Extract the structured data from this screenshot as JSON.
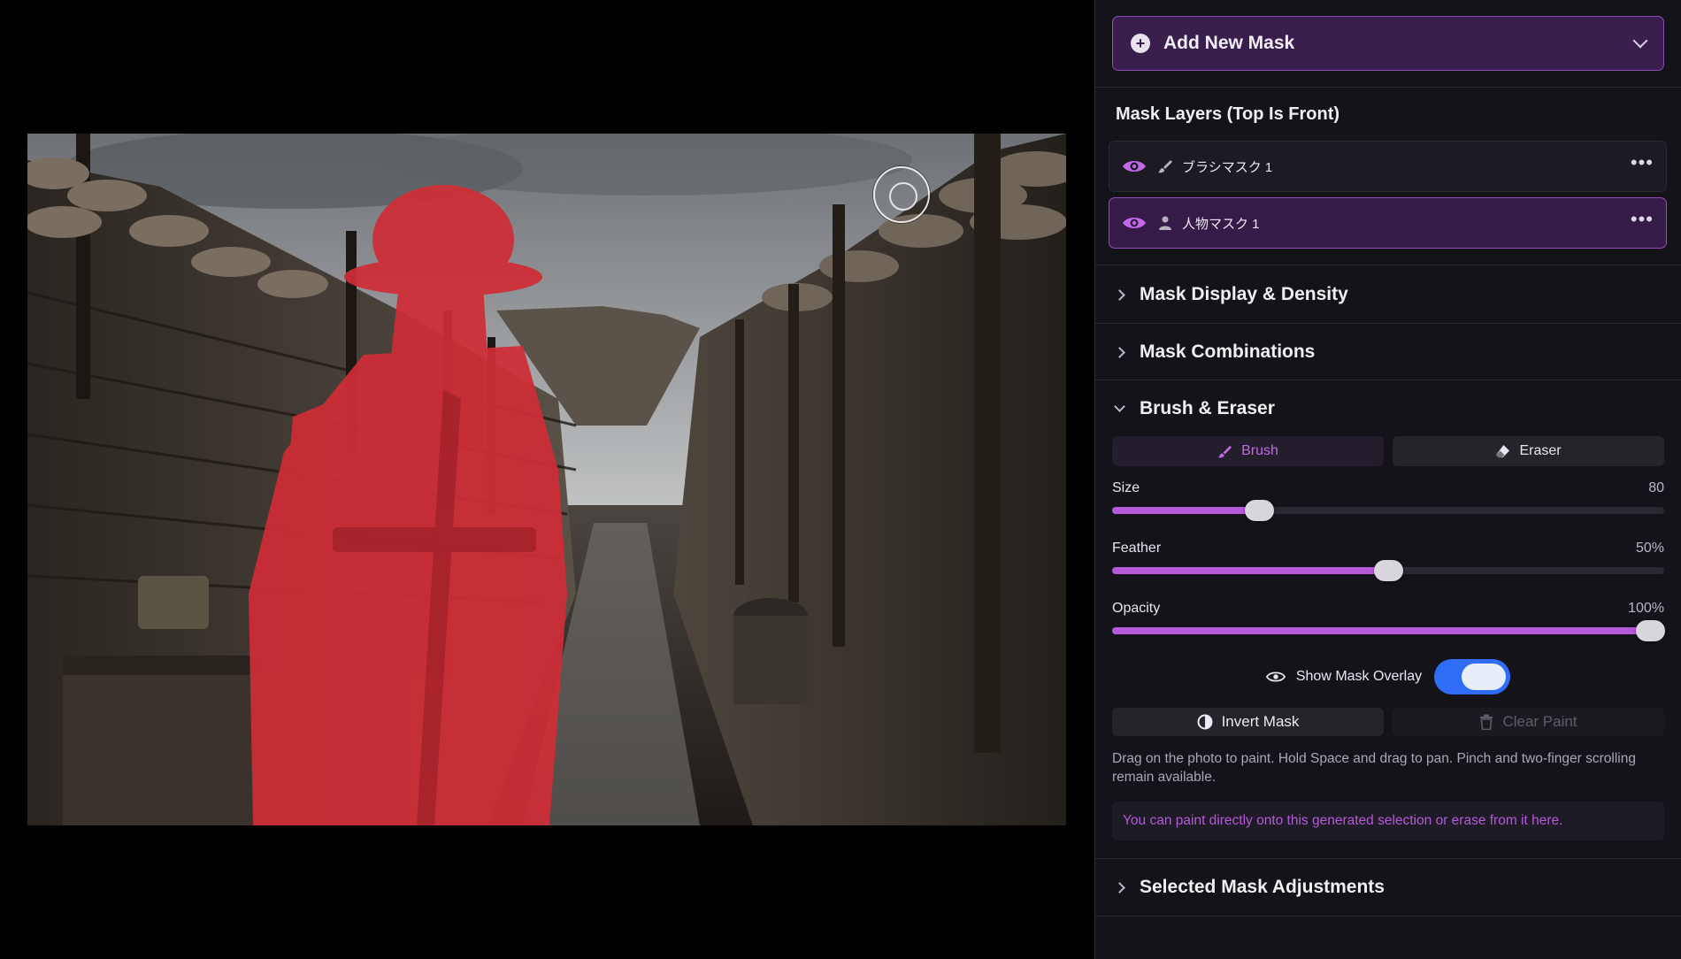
{
  "panel": {
    "add_mask": {
      "label": "Add New Mask",
      "icon": "plus-circle-icon"
    },
    "layers_title": "Mask Layers (Top Is Front)",
    "layers": [
      {
        "name": "ブラシマスク 1",
        "icon": "brush-icon",
        "visible": true,
        "selected": false
      },
      {
        "name": "人物マスク 1",
        "icon": "person-icon",
        "visible": true,
        "selected": true
      }
    ],
    "sections": {
      "display": "Mask Display & Density",
      "combinations": "Mask Combinations",
      "brush_eraser": "Brush & Eraser",
      "adjustments": "Selected Mask Adjustments"
    },
    "tools": {
      "brush": "Brush",
      "eraser": "Eraser",
      "active": "brush"
    },
    "sliders": {
      "size": {
        "label": "Size",
        "value": "80",
        "fraction": 0.266
      },
      "feather": {
        "label": "Feather",
        "value": "50%",
        "fraction": 0.5
      },
      "opacity": {
        "label": "Opacity",
        "value": "100%",
        "fraction": 0.975
      }
    },
    "overlay": {
      "label": "Show Mask Overlay",
      "on": true
    },
    "buttons": {
      "invert": "Invert Mask",
      "clear": "Clear Paint"
    },
    "hint": "Drag on the photo to paint. Hold Space and drag to pan. Pinch and two-finger scrolling remain available.",
    "notice": "You can paint directly onto this generated selection or erase from it here."
  },
  "colors": {
    "accent": "#b45ad8",
    "mask_overlay": "#d12b35",
    "toggle_on": "#2f6df6",
    "selected_layer_bg": "#361b48"
  }
}
